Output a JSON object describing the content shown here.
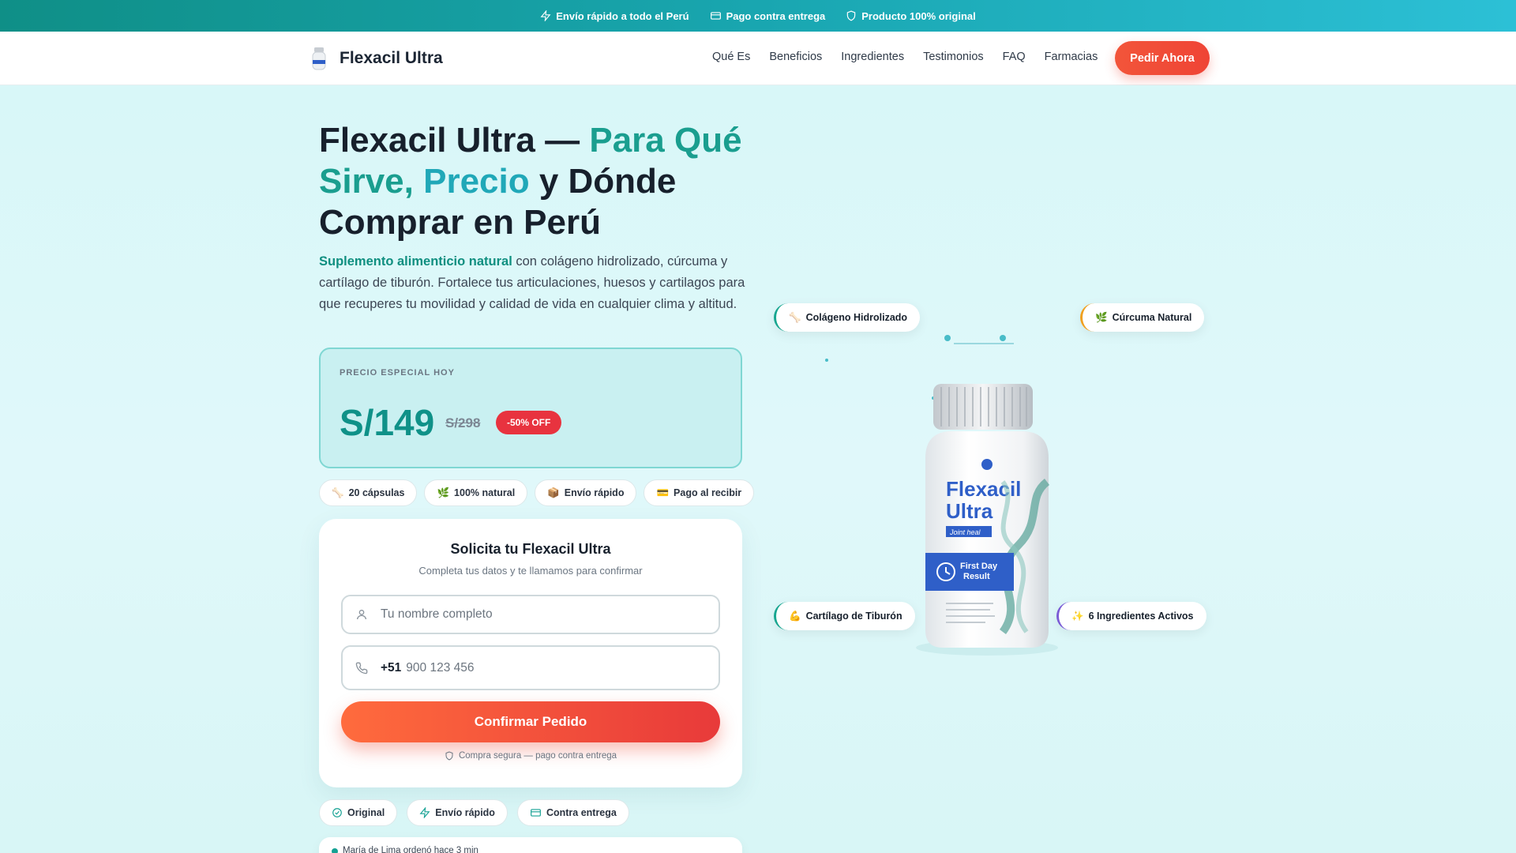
{
  "topbar": {
    "items": [
      {
        "label": "Envío rápido a todo el Perú",
        "icon": "lightning-icon"
      },
      {
        "label": "Pago contra entrega",
        "icon": "card-icon"
      },
      {
        "label": "Producto 100% original",
        "icon": "shield-icon"
      }
    ]
  },
  "nav": {
    "brand": "Flexacil Ultra",
    "links": [
      "Qué Es",
      "Beneficios",
      "Ingredientes",
      "Testimonios",
      "FAQ",
      "Farmacias"
    ],
    "cta": "Pedir Ahora"
  },
  "hero": {
    "title_part1": "Flexacil Ultra — ",
    "title_accent1": "Para Qué Sirve, ",
    "title_accent2": "Precio",
    "title_part2": " y Dónde Comprar en Perú",
    "lead_strong": "Suplemento alimenticio natural",
    "lead_rest": " con colágeno hidrolizado, cúrcuma y cartílago de tiburón. Fortalece tus articulaciones, huesos y cartilagos para que recuperes tu movilidad y calidad de vida en cualquier clima y altitud."
  },
  "price": {
    "tag": "PRECIO ESPECIAL HOY",
    "now": "S/149",
    "old": "S/298",
    "discount": "-50% OFF"
  },
  "chips": [
    {
      "emoji": "🦴",
      "label": "20 cápsulas"
    },
    {
      "emoji": "🌿",
      "label": "100% natural"
    },
    {
      "emoji": "📦",
      "label": "Envío rápido"
    },
    {
      "emoji": "💳",
      "label": "Pago al recibir"
    }
  ],
  "form": {
    "title": "Solicita tu Flexacil Ultra",
    "subtitle": "Completa tus datos y te llamamos para confirmar",
    "name_placeholder": "Tu nombre completo",
    "phone_prefix": "+51",
    "phone_placeholder": "900 123 456",
    "submit": "Confirmar Pedido",
    "secure_note": "Compra segura — pago contra entrega"
  },
  "trust": [
    {
      "label": "Original",
      "icon": "check-circle-icon"
    },
    {
      "label": "Envío rápido",
      "icon": "lightning-icon"
    },
    {
      "label": "Contra entrega",
      "icon": "card-icon"
    }
  ],
  "notification": "María de Lima ordenó hace 3 min",
  "product": {
    "label_line1": "Flexacil",
    "label_line2": "Ultra",
    "tagline": "Joint heal",
    "band_line1": "First Day",
    "band_line2": "Result"
  },
  "badges": [
    {
      "emoji": "🦴",
      "label": "Colágeno Hidrolizado"
    },
    {
      "emoji": "🌿",
      "label": "Cúrcuma Natural"
    },
    {
      "emoji": "💪",
      "label": "Cartílago de Tiburón"
    },
    {
      "emoji": "✨",
      "label": "6 Ingredientes Activos"
    }
  ],
  "colors": {
    "brand_teal": "#1a9e8f",
    "cta_red": "#ef4435",
    "discount_red": "#e8333f"
  }
}
